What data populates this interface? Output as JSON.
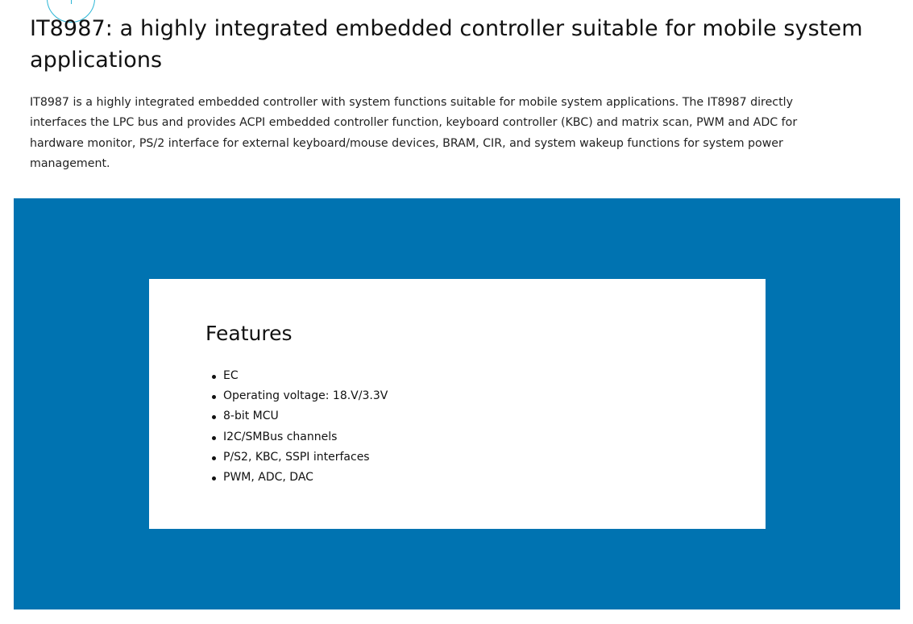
{
  "page": {
    "title": "IT8987: a highly integrated embedded controller suitable for mobile system applications",
    "intro": "IT8987 is a highly integrated embedded controller with system functions suitable for mobile system applications. The IT8987 directly interfaces the LPC bus and provides ACPI embedded controller function, keyboard controller (KBC) and matrix scan, PWM and ADC for hardware monitor, PS/2 interface for external keyboard/mouse devices, BRAM, CIR, and system wakeup functions for system power management."
  },
  "features": {
    "heading": "Features",
    "items": [
      "EC",
      "Operating voltage: 18.V/3.3V",
      "8-bit MCU",
      "I2C/SMBus channels",
      "P/S2, KBC, SSPI interfaces",
      "PWM, ADC, DAC"
    ]
  },
  "colors": {
    "band": "#0073b1",
    "accent_circle": "#2bb6d6",
    "card": "#ffffff"
  },
  "icons": {
    "top_decoration": "circle-outline-icon"
  }
}
